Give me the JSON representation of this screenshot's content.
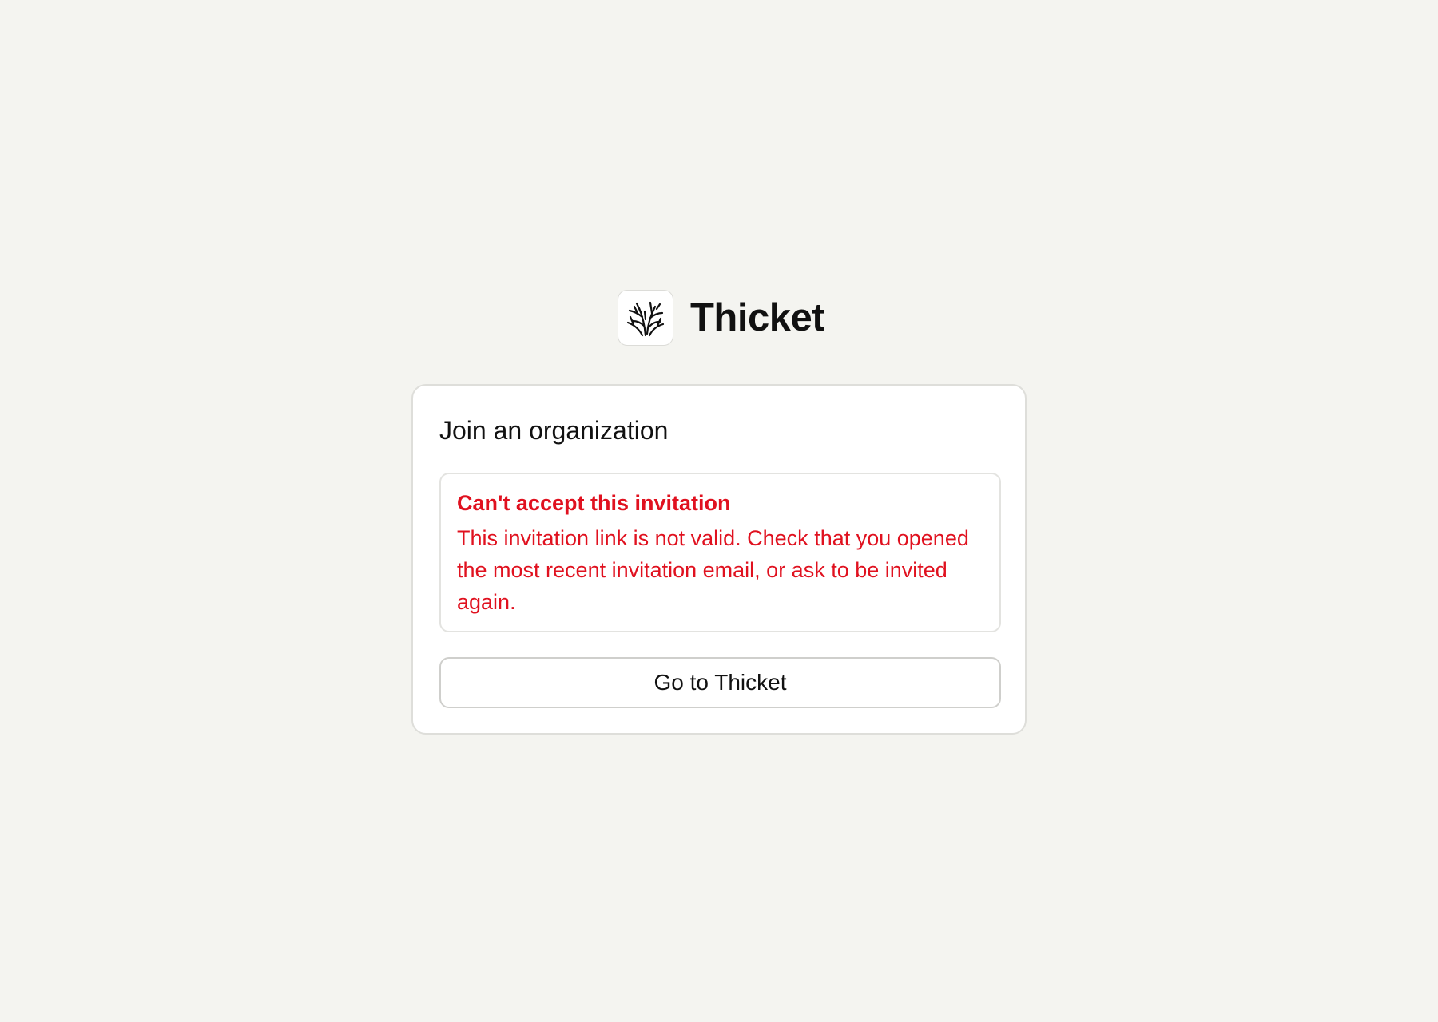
{
  "brand": {
    "name": "Thicket",
    "logo_icon": "thicket-branches-icon"
  },
  "card": {
    "title": "Join an organization",
    "alert": {
      "title": "Can't accept this invitation",
      "message": "This invitation link is not valid. Check that you opened the most recent invitation email, or ask to be invited again.",
      "color": "#e0111f"
    },
    "button_label": "Go to Thicket"
  },
  "colors": {
    "background": "#f4f4f0",
    "card": "#ffffff",
    "error": "#e0111f",
    "text": "#111111"
  }
}
